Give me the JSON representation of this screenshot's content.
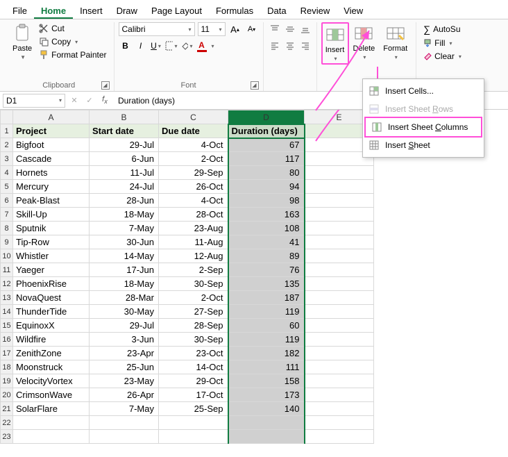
{
  "menu": {
    "tabs": [
      "File",
      "Home",
      "Insert",
      "Draw",
      "Page Layout",
      "Formulas",
      "Data",
      "Review",
      "View"
    ],
    "active": 1
  },
  "ribbon": {
    "clipboard": {
      "paste": "Paste",
      "cut": "Cut",
      "copy": "Copy",
      "fmtpainter": "Format Painter",
      "label": "Clipboard"
    },
    "font": {
      "name": "Calibri",
      "size": "11",
      "label": "Font"
    },
    "cells": {
      "insert": "Insert",
      "delete": "Delete",
      "format": "Format"
    },
    "editing": {
      "autosum": "AutoSu",
      "fill": "Fill",
      "clear": "Clear"
    }
  },
  "namebox": "D1",
  "formula": "Duration (days)",
  "columns": [
    "A",
    "B",
    "C",
    "D",
    "E"
  ],
  "header": [
    "Project",
    "Start date",
    "Due date",
    "Duration (days)"
  ],
  "rows": [
    {
      "p": "Bigfoot",
      "s": "29-Jul",
      "d": "4-Oct",
      "n": 67
    },
    {
      "p": "Cascade",
      "s": "6-Jun",
      "d": "2-Oct",
      "n": 117
    },
    {
      "p": "Hornets",
      "s": "11-Jul",
      "d": "29-Sep",
      "n": 80
    },
    {
      "p": "Mercury",
      "s": "24-Jul",
      "d": "26-Oct",
      "n": 94
    },
    {
      "p": "Peak-Blast",
      "s": "28-Jun",
      "d": "4-Oct",
      "n": 98
    },
    {
      "p": "Skill-Up",
      "s": "18-May",
      "d": "28-Oct",
      "n": 163
    },
    {
      "p": "Sputnik",
      "s": "7-May",
      "d": "23-Aug",
      "n": 108
    },
    {
      "p": "Tip-Row",
      "s": "30-Jun",
      "d": "11-Aug",
      "n": 41
    },
    {
      "p": "Whistler",
      "s": "14-May",
      "d": "12-Aug",
      "n": 89
    },
    {
      "p": "Yaeger",
      "s": "17-Jun",
      "d": "2-Sep",
      "n": 76
    },
    {
      "p": "PhoenixRise",
      "s": "18-May",
      "d": "30-Sep",
      "n": 135
    },
    {
      "p": "NovaQuest",
      "s": "28-Mar",
      "d": "2-Oct",
      "n": 187
    },
    {
      "p": "ThunderTide",
      "s": "30-May",
      "d": "27-Sep",
      "n": 119
    },
    {
      "p": "EquinoxX",
      "s": "29-Jul",
      "d": "28-Sep",
      "n": 60
    },
    {
      "p": "Wildfire",
      "s": "3-Jun",
      "d": "30-Sep",
      "n": 119
    },
    {
      "p": "ZenithZone",
      "s": "23-Apr",
      "d": "23-Oct",
      "n": 182
    },
    {
      "p": "Moonstruck",
      "s": "25-Jun",
      "d": "14-Oct",
      "n": 111
    },
    {
      "p": "VelocityVortex",
      "s": "23-May",
      "d": "29-Oct",
      "n": 158
    },
    {
      "p": "CrimsonWave",
      "s": "26-Apr",
      "d": "17-Oct",
      "n": 173
    },
    {
      "p": "SolarFlare",
      "s": "7-May",
      "d": "25-Sep",
      "n": 140
    }
  ],
  "insert_menu": {
    "cells": "Insert Cells...",
    "rows_pre": "Insert Sheet ",
    "rows_u": "R",
    "rows_post": "ows",
    "cols_pre": "Insert Sheet ",
    "cols_u": "C",
    "cols_post": "olumns",
    "sheet_pre": "Insert ",
    "sheet_u": "S",
    "sheet_post": "heet"
  }
}
